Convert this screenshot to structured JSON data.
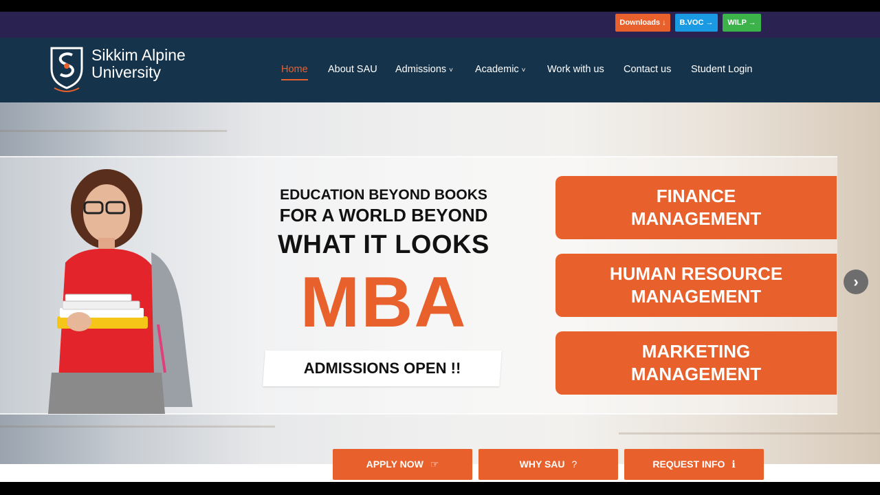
{
  "topbar": {
    "downloads_label": "Downloads ↓",
    "bvoc_label": "B.VOC →",
    "wilp_label": "WILP →"
  },
  "brand": {
    "line1": "Sikkim Alpine",
    "line2": "University"
  },
  "nav": {
    "items": [
      {
        "label": "Home",
        "active": true
      },
      {
        "label": "About SAU"
      },
      {
        "label": "Admissions",
        "dropdown": true
      },
      {
        "label": "Academic",
        "dropdown": true
      },
      {
        "label": "Work with us"
      },
      {
        "label": "Contact us"
      },
      {
        "label": "Student Login"
      }
    ],
    "caret": "˅"
  },
  "hero": {
    "line1": "EDUCATION BEYOND BOOKS",
    "line2": "FOR A WORLD BEYOND",
    "line3": "WHAT IT LOOKS",
    "big": "MBA",
    "tag": "ADMISSIONS OPEN !!",
    "programs": [
      {
        "l1": "FINANCE",
        "l2": "MANAGEMENT"
      },
      {
        "l1": "HUMAN RESOURCE",
        "l2": "MANAGEMENT"
      },
      {
        "l1": "MARKETING",
        "l2": "MANAGEMENT"
      }
    ],
    "next_glyph": "›"
  },
  "cta": {
    "apply": "APPLY NOW",
    "why": "WHY SAU",
    "info": "REQUEST INFO"
  },
  "icons": {
    "apply": "thumbs-up-icon",
    "why": "question-icon",
    "info": "info-icon"
  },
  "colors": {
    "accent": "#e8602c",
    "nav_bg": "#15334b",
    "topbar_bg": "#2a2250",
    "bvoc": "#1a9ae3",
    "wilp": "#3bb34a"
  }
}
